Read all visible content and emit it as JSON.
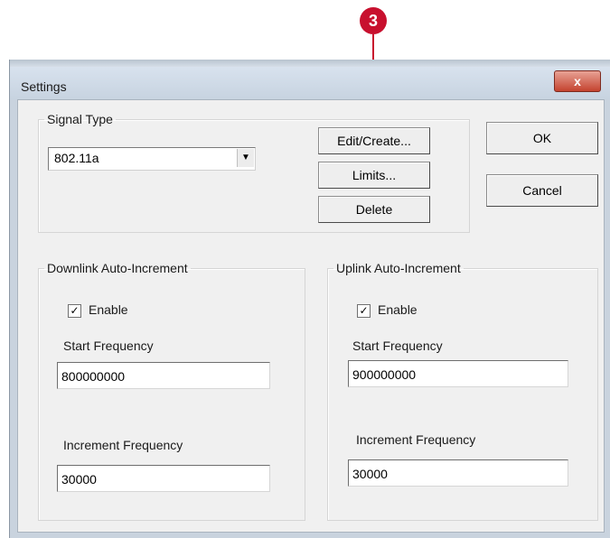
{
  "callout": {
    "number": "3",
    "color": "#c8102e"
  },
  "window": {
    "title": "Settings",
    "close_glyph": "x"
  },
  "signal_type": {
    "legend": "Signal Type",
    "selected": "802.11a",
    "buttons": {
      "edit_create": "Edit/Create...",
      "limits": "Limits...",
      "delete": "Delete"
    }
  },
  "dialog_buttons": {
    "ok": "OK",
    "cancel": "Cancel"
  },
  "downlink": {
    "legend": "Downlink Auto-Increment",
    "enable_label": "Enable",
    "enabled": true,
    "start_label": "Start Frequency",
    "start_value": "800000000",
    "increment_label": "Increment Frequency",
    "increment_value": "30000"
  },
  "uplink": {
    "legend": "Uplink Auto-Increment",
    "enable_label": "Enable",
    "enabled": true,
    "start_label": "Start Frequency",
    "start_value": "900000000",
    "increment_label": "Increment Frequency",
    "increment_value": "30000"
  }
}
